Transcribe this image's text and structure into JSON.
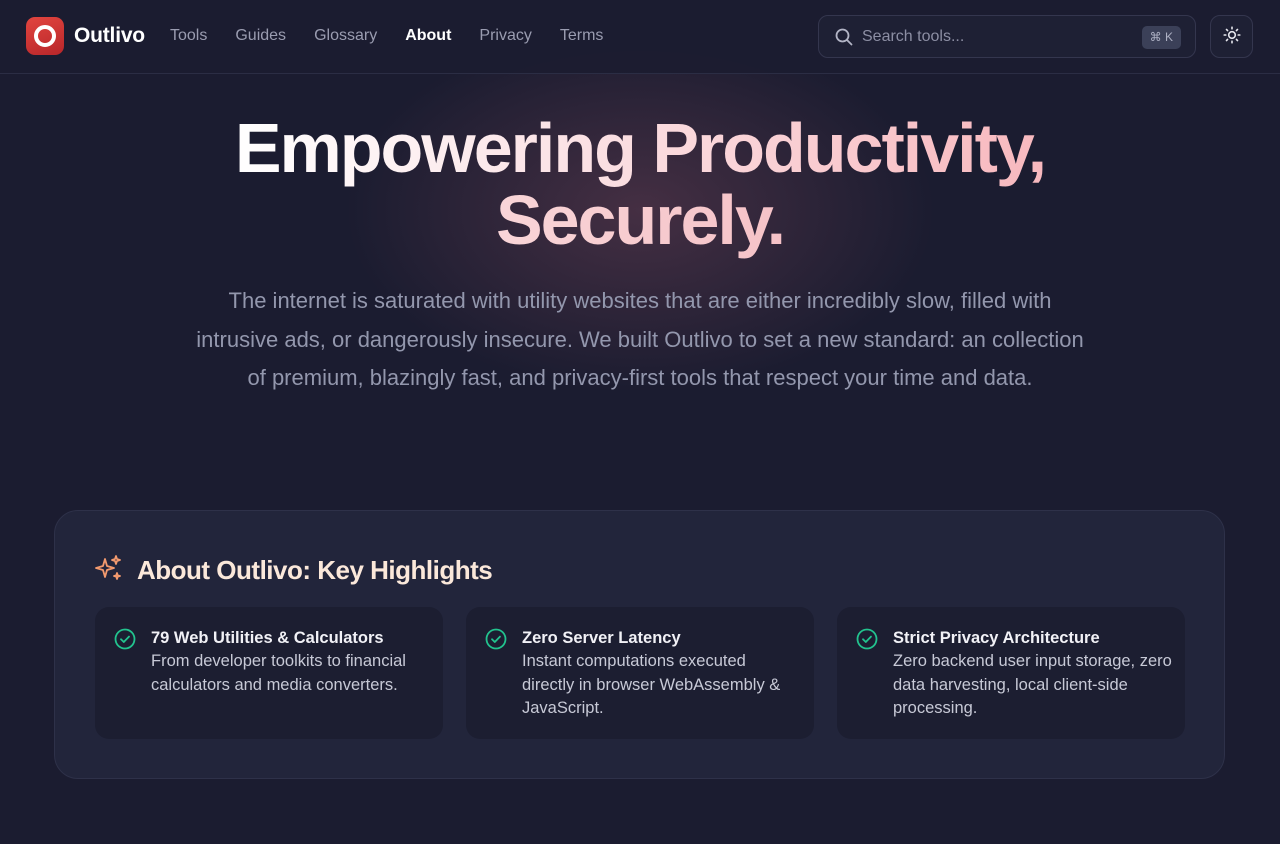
{
  "brand": {
    "name": "Outlivo"
  },
  "nav": {
    "items": [
      {
        "label": "Tools",
        "active": false
      },
      {
        "label": "Guides",
        "active": false
      },
      {
        "label": "Glossary",
        "active": false
      },
      {
        "label": "About",
        "active": true
      },
      {
        "label": "Privacy",
        "active": false
      },
      {
        "label": "Terms",
        "active": false
      }
    ]
  },
  "search": {
    "placeholder": "Search tools...",
    "shortcut": "⌘ K",
    "icon": "search-icon"
  },
  "theme_toggle": {
    "icon": "sun-icon"
  },
  "hero": {
    "title_line1": "Empowering Productivity,",
    "title_line2": "Securely.",
    "description": "The internet is saturated with utility websites that are either incredibly slow, filled with intrusive ads, or dangerously insecure. We built Outlivo to set a new standard: an collection of premium, blazingly fast, and privacy-first tools that respect your time and data."
  },
  "highlights": {
    "title": "About Outlivo: Key Highlights",
    "icon": "sparkles-icon",
    "items": [
      {
        "title": "79 Web Utilities & Calculators",
        "description": "From developer toolkits to financial calculators and media converters."
      },
      {
        "title": "Zero Server Latency",
        "description": "Instant computations executed directly in browser WebAssembly & JavaScript."
      },
      {
        "title": "Strict Privacy Architecture",
        "description": "Zero backend user input storage, zero data harvesting, local client-side processing."
      }
    ]
  },
  "colors": {
    "background": "#1b1c30",
    "accent_red": "#e2453f",
    "check_green": "#22c38e",
    "sparkle_orange": "#f39a6e"
  }
}
